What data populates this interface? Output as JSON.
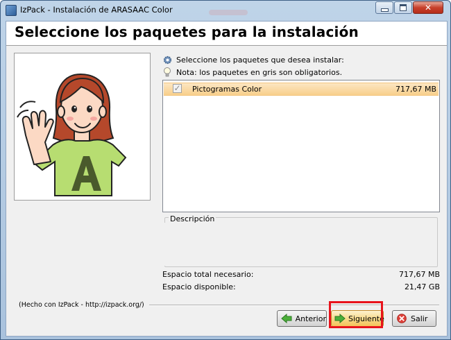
{
  "window": {
    "title": "IzPack - Instalación de ARASAAC Color",
    "buttons": {
      "minimize_icon": "minimize-icon",
      "maximize_icon": "maximize-icon",
      "close_glyph": "✕"
    }
  },
  "header": {
    "title": "Seleccione los paquetes para la instalación"
  },
  "notes": {
    "select_text": "Seleccione los paquetes que desea instalar:",
    "info_text": "Nota: los paquetes en gris son obligatorios."
  },
  "packages": [
    {
      "name": "Pictogramas Color",
      "size": "717,67 MB",
      "checked": true,
      "required": true
    }
  ],
  "description": {
    "label": "Descripción",
    "text": ""
  },
  "space": {
    "required_label": "Espacio total necesario:",
    "required_value": "717,67 MB",
    "available_label": "Espacio disponible:",
    "available_value": "21,47 GB"
  },
  "footer": {
    "made_with": "(Hecho con IzPack - http://izpack.org/)",
    "prev_label": "Anterior",
    "next_label": "Siguiente",
    "exit_label": "Salir"
  },
  "colors": {
    "highlight": "#e8131c",
    "selected_row": "#f8cf8b",
    "shirt": "#b7dd71"
  }
}
